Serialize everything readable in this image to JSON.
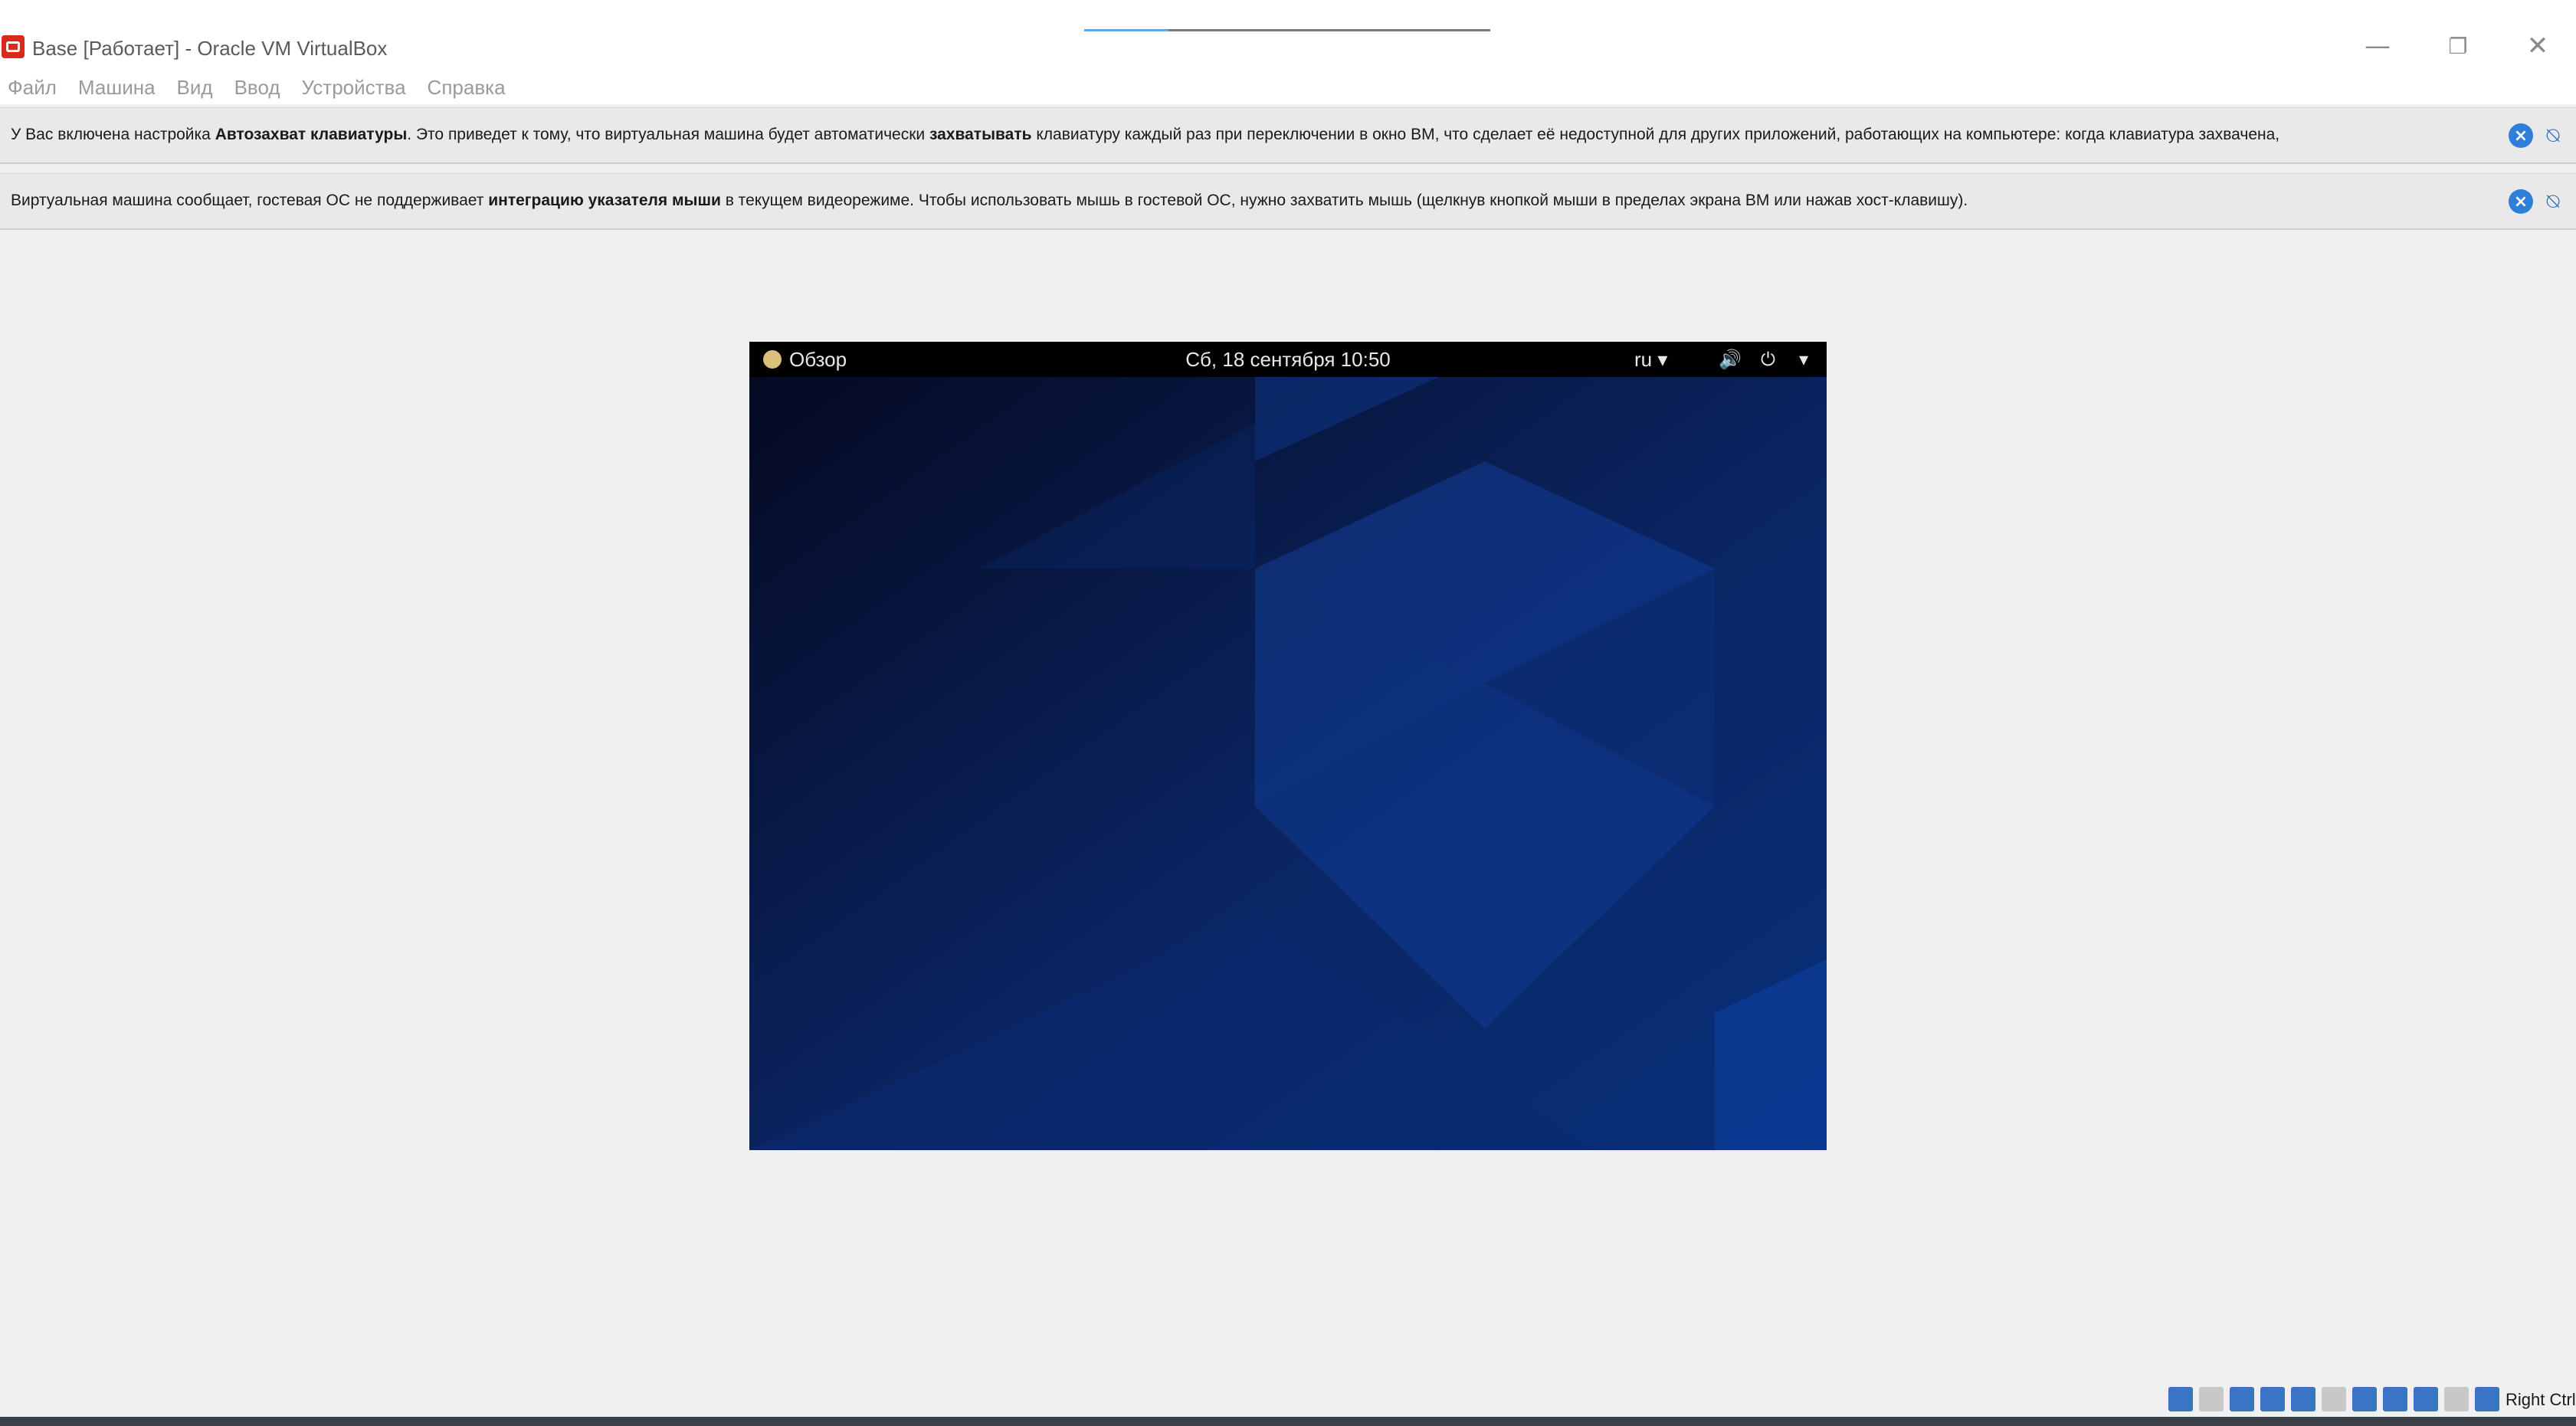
{
  "window": {
    "title": "Base [Работает] - Oracle VM VirtualBox",
    "minimize_glyph": "—",
    "restore_glyph": "❐",
    "close_glyph": "✕"
  },
  "menu": [
    {
      "label": "Файл"
    },
    {
      "label": "Машина"
    },
    {
      "label": "Вид"
    },
    {
      "label": "Ввод"
    },
    {
      "label": "Устройства"
    },
    {
      "label": "Справка"
    }
  ],
  "notices": [
    {
      "parts": [
        {
          "text": "У Вас включена настройка ",
          "bold": false
        },
        {
          "text": "Автозахват клавиатуры",
          "bold": true
        },
        {
          "text": ". Это приведет к тому, что виртуальная машина будет автоматически ",
          "bold": false
        },
        {
          "text": "захватывать",
          "bold": true
        },
        {
          "text": " клавиатуру каждый раз при переключении в окно ВМ, что сделает её недоступной для других приложений, работающих на компьютере: когда клавиатура захвачена,",
          "bold": false
        }
      ]
    },
    {
      "parts": [
        {
          "text": "Виртуальная машина сообщает, гостевая ОС не поддерживает ",
          "bold": false
        },
        {
          "text": "интеграцию указателя мыши",
          "bold": true
        },
        {
          "text": " в текущем видеорежиме. Чтобы использовать мышь в гостевой ОС, нужно захватить мышь (щелкнув кнопкой мыши в пределах экрана ВМ или нажав хост-клавишу).",
          "bold": false
        }
      ]
    }
  ],
  "guest": {
    "overview_label": "Обзор",
    "clock": "Сб, 18 сентября  10:50",
    "keyboard_layout": "ru ▾",
    "volume_glyph": "🔊",
    "power_glyph": "⏻",
    "menu_arrow": "▾"
  },
  "status_bar": {
    "host_key": "Right Ctrl"
  },
  "colors": {
    "accent": "#2f7fd9",
    "guest_bg": "#0a1a45"
  }
}
